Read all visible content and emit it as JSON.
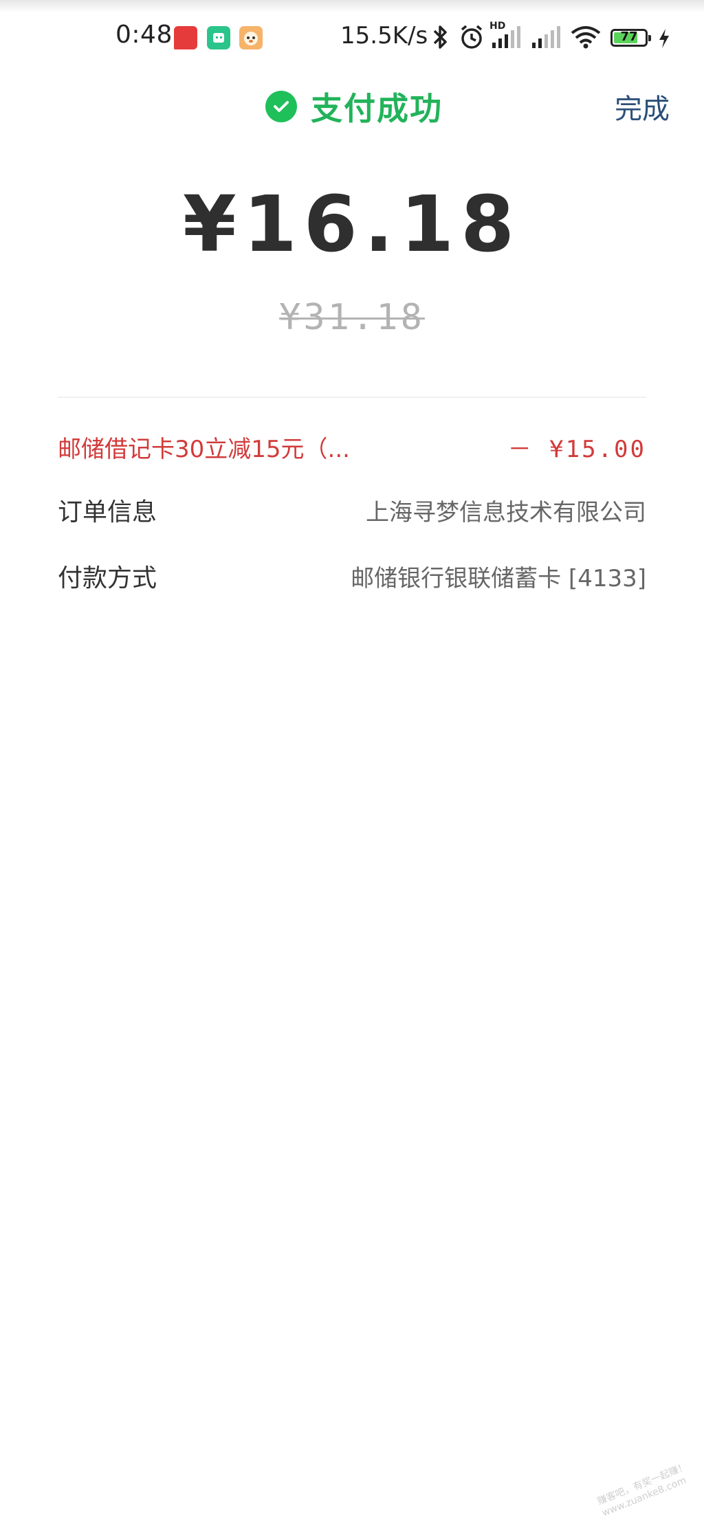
{
  "status_bar": {
    "time": "0:48",
    "apps": [
      "app-red",
      "app-green",
      "app-orange"
    ],
    "network_speed": "15.5K/s",
    "signal_label": "HD",
    "battery": "77",
    "battery_level": 0.77
  },
  "header": {
    "title": "支付成功",
    "done_label": "完成",
    "accent_color": "#22b35a"
  },
  "payment": {
    "amount": "¥16.18",
    "original_amount": "¥31.18"
  },
  "details": {
    "discount_label": "邮储借记卡30立减15元（...",
    "discount_value": "－ ¥15.00",
    "order_label": "订单信息",
    "order_value": "上海寻梦信息技术有限公司",
    "payment_method_label": "付款方式",
    "payment_method_value": "邮储银行银联储蓄卡 [4133]"
  },
  "watermark": {
    "line1": "赚客吧，有奖一起赚！",
    "line2": "www.zuanke8.com"
  },
  "colors": {
    "discount": "#d23a3a",
    "done": "#2b4f7a"
  }
}
